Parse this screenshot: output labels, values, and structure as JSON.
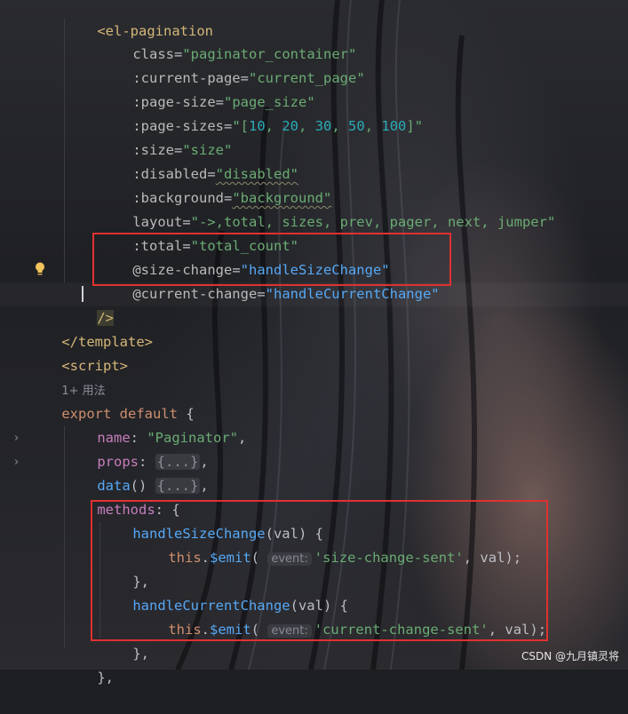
{
  "editor": {
    "lines": {
      "l01": [
        "<",
        "el-pagination"
      ],
      "l02": [
        "class",
        "=",
        "\"paginator_container\""
      ],
      "l03": [
        ":current-page",
        "=",
        "\"current_page\""
      ],
      "l04": [
        ":page-size",
        "=",
        "\"page_size\""
      ],
      "l05": [
        ":page-sizes",
        "=",
        "\"[",
        "10",
        ", ",
        "20",
        ", ",
        "30",
        ", ",
        "50",
        ", ",
        "100",
        "]\""
      ],
      "l06": [
        ":size",
        "=",
        "\"size\""
      ],
      "l07": [
        ":disabled",
        "=",
        "\"disabled\""
      ],
      "l08": [
        ":background",
        "=",
        "\"background\""
      ],
      "l09": [
        "layout",
        "=",
        "\"->,total, sizes, prev, pager, next, jumper\""
      ],
      "l10": [
        ":total",
        "=",
        "\"total_count\""
      ],
      "l11": [
        "@size-change",
        "=",
        "\"handleSizeChange\""
      ],
      "l12": [
        "@current-change",
        "=",
        "\"handleCurrentChange\""
      ],
      "l13": [
        "/>"
      ],
      "l14": [
        "</",
        "template",
        ">"
      ],
      "l15": [
        "<",
        "script",
        ">"
      ],
      "l16": [
        "1+ 用法"
      ],
      "l17": [
        "export",
        "default",
        "{"
      ],
      "l18": [
        "name",
        ": ",
        "\"Paginator\"",
        ","
      ],
      "l19": [
        "props",
        ": ",
        "{...}",
        ","
      ],
      "l20": [
        "data",
        "() ",
        "{...}",
        ","
      ],
      "l21": [
        "methods",
        ": {"
      ],
      "l22": [
        "handleSizeChange",
        "(val) {"
      ],
      "l23": [
        "this",
        ".",
        "$emit",
        "(",
        "event:",
        "'size-change-sent'",
        ", val);"
      ],
      "l24": [
        "},"
      ],
      "l25": [
        "handleCurrentChange",
        "(val) {"
      ],
      "l26": [
        "this",
        ".",
        "$emit",
        "(",
        "event:",
        "'current-change-sent'",
        ", val);"
      ],
      "l27": [
        "},"
      ],
      "l28": [
        "},"
      ]
    }
  },
  "icons": {
    "bulb": "lightbulb-icon",
    "fold": "chevron-right-icon"
  },
  "colors": {
    "tag": "#d5b778",
    "string": "#6aab73",
    "keyword": "#cf8e6d",
    "property": "#c77dbb",
    "function": "#56a8f5",
    "number": "#2aacb8",
    "highlight_box": "#e03131"
  },
  "watermark": "CSDN @九月镇灵将"
}
